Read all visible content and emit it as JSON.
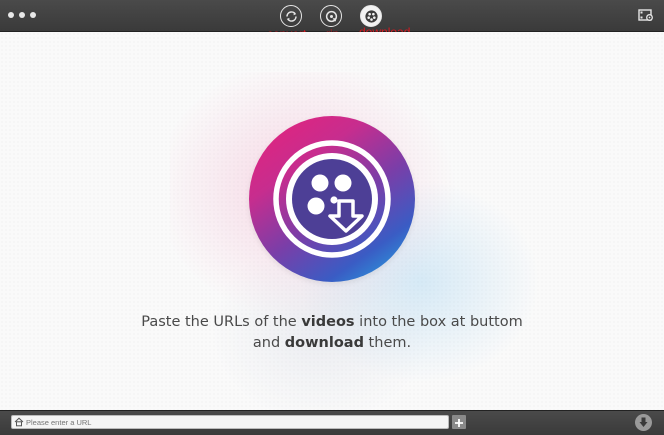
{
  "window": {
    "traffic_lights": [
      "close",
      "minimize",
      "zoom"
    ]
  },
  "toolbar": {
    "tabs": [
      {
        "id": "convert",
        "label": "convert",
        "icon": "convert-icon"
      },
      {
        "id": "rip",
        "label": "rip",
        "icon": "rip-disc-icon"
      },
      {
        "id": "download",
        "label": "download",
        "icon": "film-reel-icon"
      }
    ],
    "active_tab": "download",
    "preferences_icon": "film-settings-icon",
    "label_color": "#d8181f"
  },
  "main": {
    "logo_icon": "video-download-icon",
    "message": {
      "part1": "Paste the URLs of the ",
      "bold1": "videos",
      "part2": " into the box at buttom",
      "part3": "and ",
      "bold2": "download",
      "part4": " them."
    },
    "gradient_colors": [
      "#e9217a",
      "#7a3ea8",
      "#23b3e6"
    ]
  },
  "bottom": {
    "url_placeholder": "Please enter a URL",
    "url_value": "",
    "home_icon": "home-icon",
    "add_icon": "plus-icon",
    "download_icon": "download-arrow-icon"
  }
}
